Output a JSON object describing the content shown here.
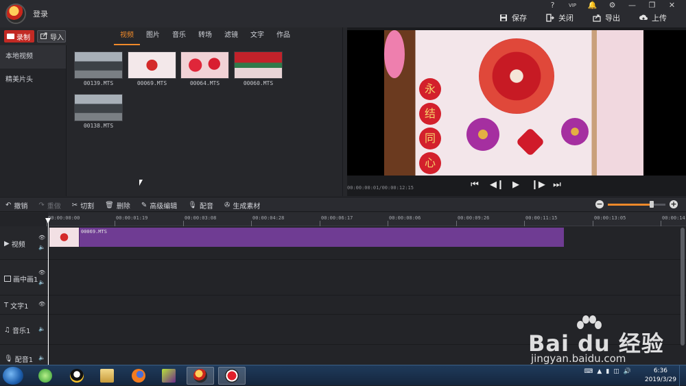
{
  "titlebar": {
    "login": "登录",
    "window_controls": [
      "?",
      "VIP",
      "🔔",
      "⚙",
      "—",
      "❐",
      "✕"
    ],
    "actions": [
      {
        "label": "保存",
        "icon": "save-icon"
      },
      {
        "label": "关闭",
        "icon": "close-project-icon"
      },
      {
        "label": "导出",
        "icon": "export-icon"
      },
      {
        "label": "上传",
        "icon": "upload-icon"
      }
    ]
  },
  "library": {
    "record_label": "录制",
    "import_label": "导入",
    "tabs": [
      "视频",
      "图片",
      "音乐",
      "转场",
      "滤镜",
      "文字",
      "作品"
    ],
    "active_tab": "视频",
    "side_items": [
      "本地视频",
      "精美片头"
    ],
    "files": [
      {
        "name": "00139.MTS"
      },
      {
        "name": "00069.MTS"
      },
      {
        "name": "00064.MTS"
      },
      {
        "name": "00060.MTS"
      },
      {
        "name": "00138.MTS"
      }
    ]
  },
  "preview": {
    "time": "00:00:00:01/00:00:12:15",
    "couplet": [
      "永",
      "结",
      "同",
      "心"
    ]
  },
  "edit_toolbar": {
    "tools": [
      {
        "label": "撤销",
        "icon": "undo-icon",
        "enabled": true
      },
      {
        "label": "重做",
        "icon": "redo-icon",
        "enabled": false
      },
      {
        "label": "切割",
        "icon": "scissors-icon",
        "enabled": true
      },
      {
        "label": "删除",
        "icon": "trash-icon",
        "enabled": true
      },
      {
        "label": "高级编辑",
        "icon": "pencil-icon",
        "enabled": true
      },
      {
        "label": "配音",
        "icon": "microphone-icon",
        "enabled": true
      },
      {
        "label": "生成素材",
        "icon": "film-reel-icon",
        "enabled": true
      }
    ],
    "zoom_level": 0.76
  },
  "timeline": {
    "ticks": [
      "00:00:00:00",
      "00:00:01:19",
      "00:00:03:08",
      "00:00:04:28",
      "00:00:06:17",
      "00:00:08:06",
      "00:00:09:26",
      "00:00:11:15",
      "00:00:13:05",
      "00:00:14:"
    ],
    "tracks": [
      {
        "label": "视频",
        "icon": "video-track-icon"
      },
      {
        "label": "画中画1",
        "icon": "pip-track-icon"
      },
      {
        "label": "文字1",
        "icon": "text-track-icon"
      },
      {
        "label": "音乐1",
        "icon": "music-track-icon"
      },
      {
        "label": "配音1",
        "icon": "mic-track-icon"
      }
    ],
    "clip_name": "00069.MTS"
  },
  "taskbar": {
    "time": "6:36",
    "date": "2019/3/29"
  },
  "watermark": {
    "brand": "Bai du 经验",
    "url": "jingyan.baidu.com"
  },
  "colors": {
    "accent": "#f08a2a",
    "record_red": "#c22a24",
    "clip_purple": "#6f3c93"
  }
}
